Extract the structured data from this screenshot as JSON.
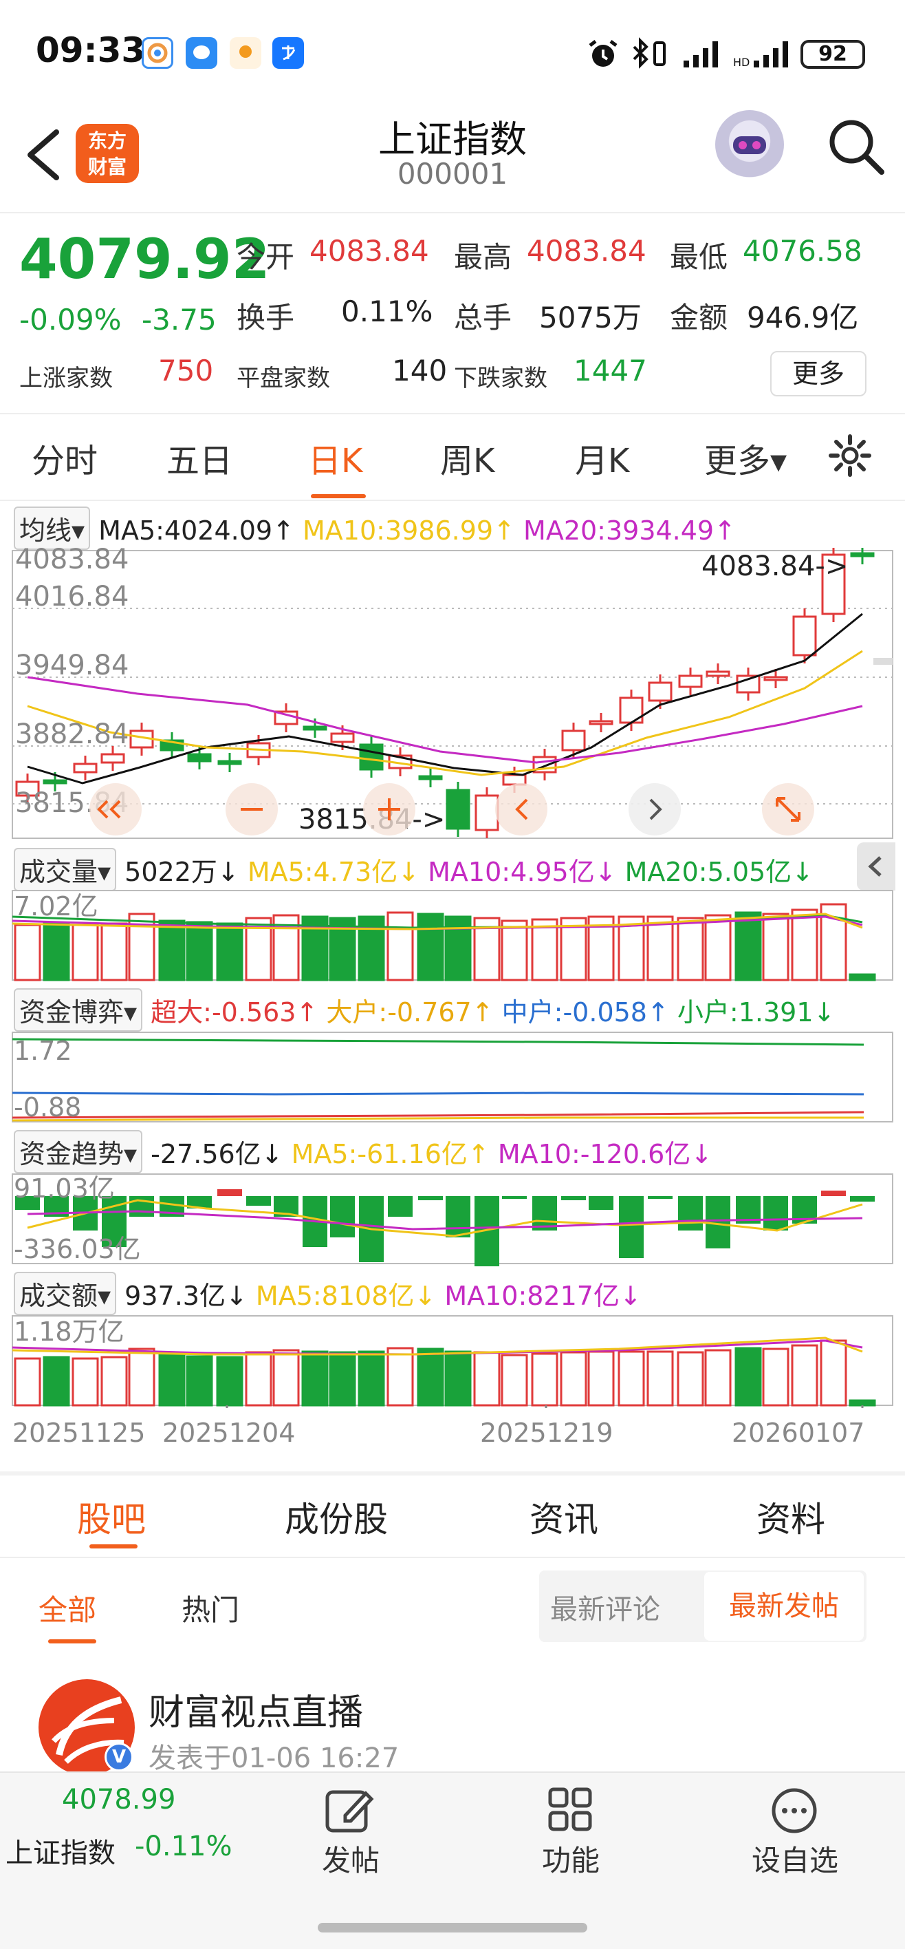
{
  "status_bar": {
    "time": "09:33",
    "battery": "92"
  },
  "header": {
    "logo_line1": "东方",
    "logo_line2": "财富",
    "title": "上证指数",
    "code": "000001"
  },
  "quote": {
    "price": "4079.92",
    "change_pct": "-0.09%",
    "change": "-3.75",
    "open_label": "今开",
    "open": "4083.84",
    "high_label": "最高",
    "high": "4083.84",
    "low_label": "最低",
    "low": "4076.58",
    "turnover_label": "换手",
    "turnover": "0.11%",
    "volume_label": "总手",
    "volume": "5075万",
    "amount_label": "金额",
    "amount": "946.9亿",
    "up_label": "上涨家数",
    "up_count": "750",
    "flat_label": "平盘家数",
    "flat_count": "140",
    "down_label": "下跌家数",
    "down_count": "1447",
    "more_label": "更多"
  },
  "period_tabs": [
    {
      "label": "分时"
    },
    {
      "label": "五日"
    },
    {
      "label": "日K",
      "active": true
    },
    {
      "label": "周K"
    },
    {
      "label": "月K"
    },
    {
      "label": "更多▾"
    }
  ],
  "ma_row": {
    "selector": "均线▾",
    "ma5": "MA5:4024.09↑",
    "ma10": "MA10:3986.99↑",
    "ma20": "MA20:3934.49↑"
  },
  "kline": {
    "y_labels": [
      "4083.84",
      "4016.84",
      "3949.84",
      "3882.84",
      "3815.84"
    ],
    "max_marker": "4083.84->",
    "min_marker": "3815.84->"
  },
  "volume_row": {
    "selector": "成交量▾",
    "value": "5022万↓",
    "ma5": "MA5:4.73亿↓",
    "ma10": "MA10:4.95亿↓",
    "ma20": "MA20:5.05亿↓",
    "axis_max": "7.02亿"
  },
  "capital_game_row": {
    "selector": "资金博弈▾",
    "super": "超大:-0.563↑",
    "large": "大户:-0.767↑",
    "medium": "中户:-0.058↑",
    "small": "小户:1.391↓",
    "axis_max": "1.72",
    "axis_min": "-0.88"
  },
  "capital_trend_row": {
    "selector": "资金趋势▾",
    "value": "-27.56亿↓",
    "ma5": "MA5:-61.16亿↑",
    "ma10": "MA10:-120.6亿↓",
    "axis_max": "91.03亿",
    "axis_min": "-336.03亿"
  },
  "amount_row": {
    "selector": "成交额▾",
    "value": "937.3亿↓",
    "ma5": "MA5:8108亿↓",
    "ma10": "MA10:8217亿↓",
    "axis_max": "1.18万亿"
  },
  "date_axis": [
    "20251125",
    "20251204",
    "20251219",
    "20260107"
  ],
  "main_tabs": [
    {
      "label": "股吧",
      "active": true
    },
    {
      "label": "成份股"
    },
    {
      "label": "资讯"
    },
    {
      "label": "资料"
    }
  ],
  "sub_tabs": [
    {
      "label": "全部",
      "active": true
    },
    {
      "label": "热门"
    }
  ],
  "sort_options": {
    "latest_comment": "最新评论",
    "latest_post": "最新发帖"
  },
  "post": {
    "author": "财富视点直播",
    "time": "发表于01-06 16:27",
    "badge": "V"
  },
  "bottom_nav": {
    "price": "4078.99",
    "name": "上证指数",
    "pct": "-0.11%",
    "post": "发帖",
    "functions": "功能",
    "watchlist": "设自选"
  },
  "colors": {
    "up": "#e03a3a",
    "down": "#19a23a",
    "accent": "#f25f1c",
    "ma5": "#111111",
    "ma10": "#f0c419",
    "ma20": "#c42ac2"
  }
}
